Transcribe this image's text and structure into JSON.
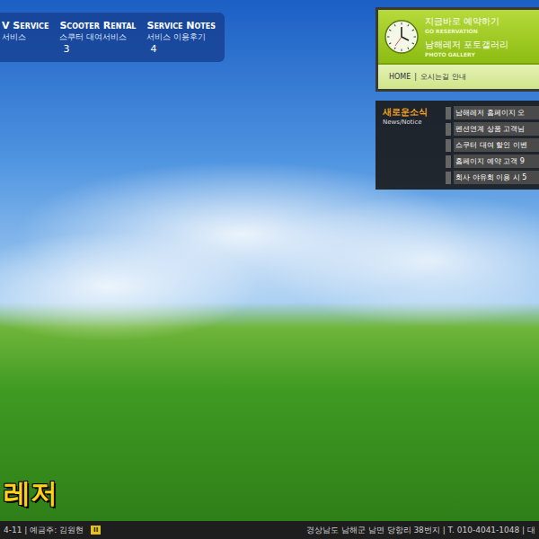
{
  "nav": [
    {
      "title": "V Service",
      "sub": "서비스"
    },
    {
      "title": "Scooter Rental",
      "sub": "스쿠터 대여서비스",
      "num": "3"
    },
    {
      "title": "Service Notes",
      "sub": "서비스 이용후기",
      "num": "4"
    }
  ],
  "quick_links": [
    {
      "title": "지금바로 예약하기",
      "sub": "GO RESERVATION"
    },
    {
      "title": "남해레저 포토갤러리",
      "sub": "PHOTO GALLERY"
    }
  ],
  "breadcrumb": {
    "home": "HOME",
    "separator": "|",
    "current": "오시는길 안내"
  },
  "news": {
    "title": "새로운소식",
    "sub": "News/Notice",
    "items": [
      "남해레저 홈페이지 오",
      "펜션연계 상품 고객님",
      "스쿠터 대여 할인 이벤",
      "홈페이지 예약 고객 9",
      "회사 야유회 이용 시 5"
    ]
  },
  "logo": "레저",
  "footer": {
    "left": "4-11 | 예금주: 김원현",
    "pause": "II",
    "right": "경상남도 남해군 남면 당항리 38번지 | T. 010-4041-1048 | 대"
  }
}
